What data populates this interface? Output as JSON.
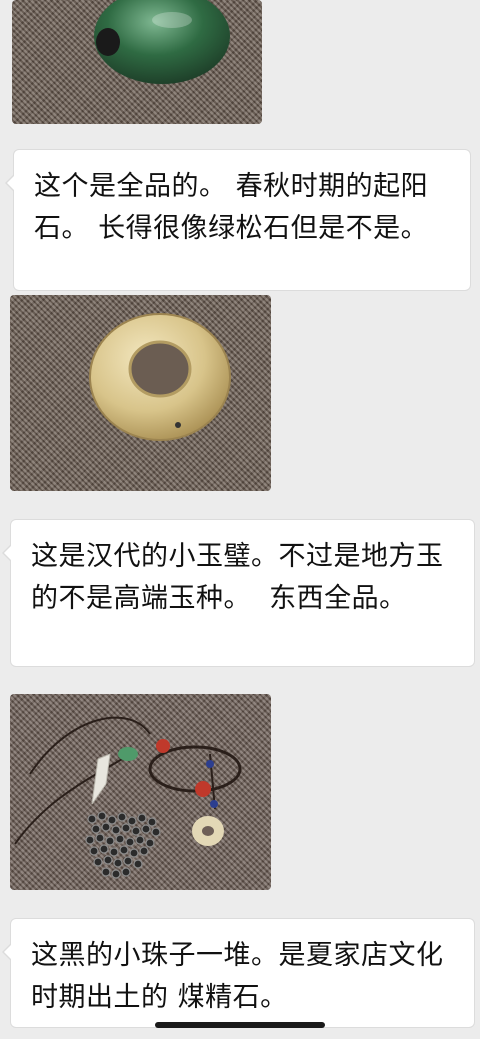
{
  "messages": [
    {
      "type": "image",
      "subject": "green-bead-photo"
    },
    {
      "type": "text",
      "text": "这个是全品的。 春秋时期的起阳石。 长得很像绿松石但是不是。"
    },
    {
      "type": "image",
      "subject": "jade-bi-disc-photo"
    },
    {
      "type": "text",
      "text": "这是汉代的小玉璧。不过是地方玉的不是高端玉种。  东西全品。"
    },
    {
      "type": "image",
      "subject": "necklace-and-beads-photo"
    },
    {
      "type": "text",
      "text": "这黑的小珠子一堆。是夏家店文化时期出土的 煤精石。"
    }
  ],
  "colors": {
    "background": "#ececec",
    "bubble": "#ffffff",
    "bubble_border": "#dcdcdc",
    "text": "#111111"
  }
}
